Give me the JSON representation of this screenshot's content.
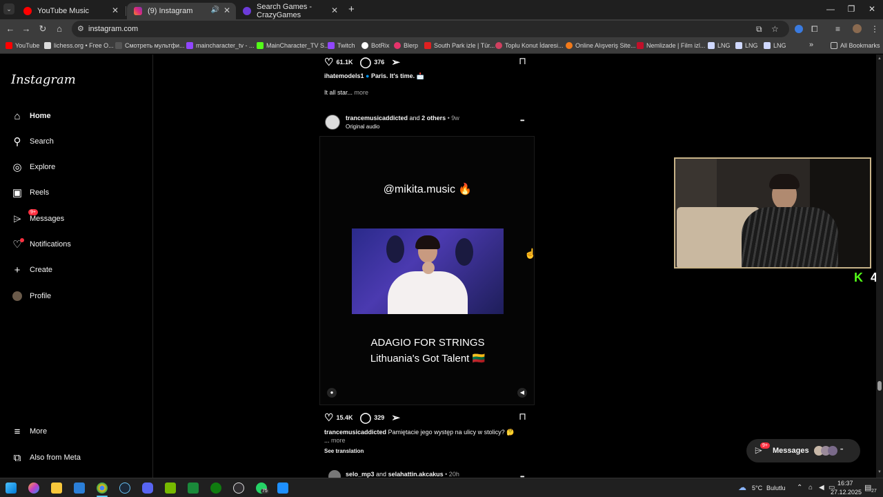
{
  "browser": {
    "tabs": [
      {
        "title": "YouTube Music",
        "active": false,
        "color": "#ff0000"
      },
      {
        "title": "(9) Instagram",
        "active": true,
        "color": "#e1306c"
      },
      {
        "title": "Search Games - CrazyGames",
        "active": false,
        "color": "#6c3bd9"
      }
    ],
    "new_tab_glyph": "+",
    "url": "instagram.com",
    "bookmarks": [
      {
        "label": "YouTube",
        "color": "#ff0000"
      },
      {
        "label": "lichess.org • Free O...",
        "color": "#dddddd"
      },
      {
        "label": "Смотреть мультфи...",
        "color": "#555555"
      },
      {
        "label": "maincharacter_tv - ...",
        "color": "#9146ff"
      },
      {
        "label": "MainCharacter_TV S...",
        "color": "#53fc18"
      },
      {
        "label": "Twitch",
        "color": "#9146ff"
      },
      {
        "label": "BotRix",
        "color": "#ffffff"
      },
      {
        "label": "Blerp",
        "color": "#e6336b"
      },
      {
        "label": "South Park izle | Tür...",
        "color": "#e02020"
      },
      {
        "label": "Toplu Konut İdaresi...",
        "color": "#d04060"
      },
      {
        "label": "Online Alışveriş Site...",
        "color": "#f27a1a"
      },
      {
        "label": "Nemlizade | Film izl...",
        "color": "#c0102a"
      },
      {
        "label": "LNG",
        "color": "#cfd8ff"
      },
      {
        "label": "LNG",
        "color": "#cfd8ff"
      },
      {
        "label": "LNG",
        "color": "#cfd8ff"
      }
    ],
    "all_bookmarks": "All Bookmarks"
  },
  "sidebar": {
    "logo": "Instagram",
    "items": [
      {
        "label": "Home",
        "icon": "home-icon",
        "glyph": "⌂"
      },
      {
        "label": "Search",
        "icon": "search-icon",
        "glyph": "⚲"
      },
      {
        "label": "Explore",
        "icon": "explore-icon",
        "glyph": "◎"
      },
      {
        "label": "Reels",
        "icon": "reels-icon",
        "glyph": "▣"
      },
      {
        "label": "Messages",
        "icon": "messages-icon",
        "glyph": "⌲",
        "badge": "9+"
      },
      {
        "label": "Notifications",
        "icon": "heart-icon",
        "glyph": "♡"
      },
      {
        "label": "Create",
        "icon": "plus-icon",
        "glyph": "+"
      },
      {
        "label": "Profile",
        "icon": "avatar",
        "glyph": "●"
      }
    ],
    "more": {
      "label": "More",
      "glyph": "≡"
    },
    "meta": {
      "label": "Also from Meta",
      "glyph": "⧉"
    }
  },
  "post1": {
    "likes": "61.1K",
    "comments": "376",
    "username": "ihatemodels1",
    "caption": "Paris. It's time. 📩",
    "excerpt": "It all star...",
    "more": "more"
  },
  "post2": {
    "author": "trancemusicaddicted",
    "and": "and",
    "others": "2 others",
    "age": "• 9w",
    "audio": "Original audio",
    "menu": "•••",
    "video_handle": "@mikita.music 🔥",
    "video_line1": "ADAGIO FOR STRINGS",
    "video_line2": "Lithuania's Got Talent 🇱🇹",
    "likes": "15.4K",
    "comments": "329",
    "caption": "Pamiętacie jego występ na ulicy w stolicy? 🤔",
    "more_prefix": "...",
    "more": "more",
    "see_translation": "See translation"
  },
  "post3": {
    "author": "selo_mp3",
    "and": "and",
    "other": "selahattin.akcakus",
    "age": "• 20h",
    "menu": "•••"
  },
  "overlay": {
    "kick_letter": "K",
    "viewer_count": "4"
  },
  "messages_pill": {
    "label": "Messages",
    "badge": "9+",
    "more": "•••"
  },
  "taskbar": {
    "weather_temp": "5°C",
    "weather_text": "Bulutlu",
    "time": "16:37",
    "date": "27.12.2025",
    "notif_count": "27",
    "badge75": "75"
  }
}
